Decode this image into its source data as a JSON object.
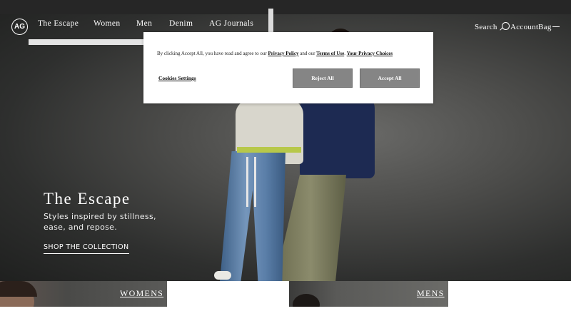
{
  "nav": {
    "logo": "AG",
    "items": [
      "The Escape",
      "Women",
      "Men",
      "Denim",
      "AG Journals"
    ],
    "search": "Search",
    "account": "Account",
    "bag": "Bag"
  },
  "hero": {
    "title": "The Escape",
    "subtitle": "Styles inspired by stillness, ease, and repose.",
    "cta": "SHOP THE COLLECTION"
  },
  "cookie": {
    "text_prefix": "By clicking Accept All, you have read and agree to our",
    "privacy_policy": "Privacy Policy",
    "and": "and our",
    "terms": "Terms of Use",
    "separator": ".",
    "privacy_choices": "Your Privacy Choices",
    "settings": "Cookies Settings",
    "reject": "Reject All",
    "accept": "Accept All"
  },
  "tiles": {
    "womens": "WOMENS",
    "mens": "MENS"
  },
  "colors": {
    "topbar": "#262626",
    "button": "#858585",
    "text_light": "#ffffff"
  }
}
